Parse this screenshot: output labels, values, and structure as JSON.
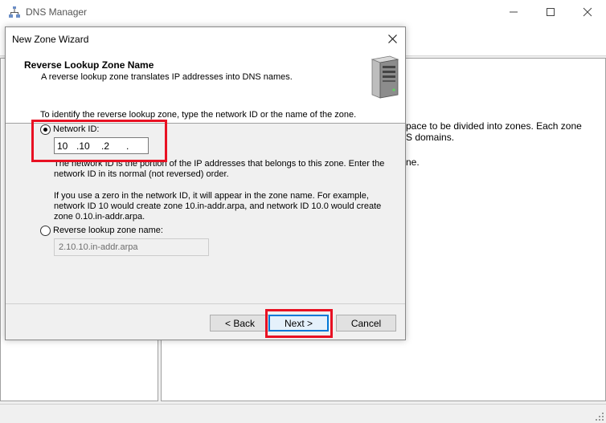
{
  "app": {
    "title": "DNS Manager"
  },
  "background_text": [
    "pace to be divided into zones. Each zone",
    "S domains.",
    "ne."
  ],
  "dialog": {
    "title": "New Zone Wizard",
    "header_title": "Reverse Lookup Zone Name",
    "header_subtitle": "A reverse lookup zone translates IP addresses into DNS names.",
    "intro": "To identify the reverse lookup zone, type the network ID or the name of the zone.",
    "network_id_label": "Network ID:",
    "network_id_segments": [
      "10",
      ".10",
      ".2",
      "."
    ],
    "network_id_help_1": "The network ID is the portion of the IP addresses that belongs to this zone. Enter the",
    "network_id_help_2": "network ID in its normal (not reversed) order.",
    "zero_help_1": "If you use a zero in the network ID, it will appear in the zone name. For example,",
    "zero_help_2": "network ID 10 would create zone 10.in-addr.arpa, and network ID 10.0 would create",
    "zero_help_3": "zone 0.10.in-addr.arpa.",
    "zone_name_label": "Reverse lookup zone name:",
    "zone_name_value": "2.10.10.in-addr.arpa",
    "back_label": "< Back",
    "next_label": "Next >",
    "cancel_label": "Cancel",
    "selected_option": "Network ID"
  },
  "colors": {
    "highlight": "#e81123",
    "focus": "#0078d7"
  }
}
